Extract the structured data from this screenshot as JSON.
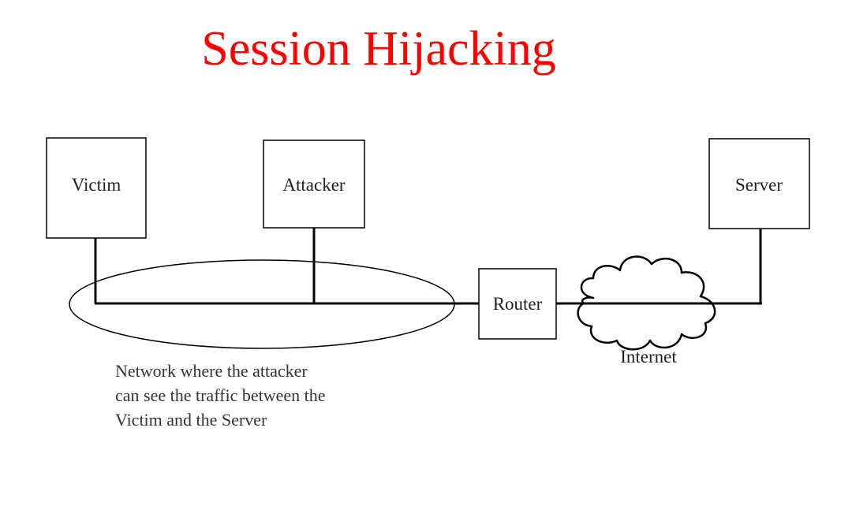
{
  "title": "Session Hijacking",
  "colors": {
    "title": "#ff0000",
    "line": "#000000",
    "text": "#222222"
  },
  "nodes": {
    "victim": "Victim",
    "attacker": "Attacker",
    "server": "Server",
    "router": "Router"
  },
  "cloud_label": "Internet",
  "caption": {
    "line1": "Network where the attacker",
    "line2": "can see the traffic between the",
    "line3": "Victim and the Server"
  }
}
